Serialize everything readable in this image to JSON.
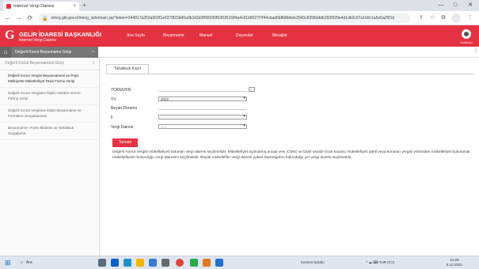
{
  "browser": {
    "tab_title": "İnternet Vergi Dairesi",
    "tab_close": "×",
    "new_tab": "+",
    "url": "intvrg.gib.gov.tr/intvrg_side/main.jsp?token=344917a3f1fa969f1e0379f22d40a3b2d3d3f00f290f63f1f51584a4c91b8027f7f44cbad0b8b8b6eb2043c835fbbfdb3926f29e4d1db2c97a1b0c1a5e5a25f1b",
    "min": "—",
    "max": "□",
    "close": "✕",
    "back": "←",
    "forward": "→",
    "reload": "⟳",
    "lock": "🔒",
    "share": "⇪",
    "star": "☆",
    "ext": "⧉",
    "menu": "⋮"
  },
  "header": {
    "logo_title": "GELİR İDARESİ BAŞKANLIĞI",
    "logo_subtitle": "İnternet Vergi Dairesi",
    "menu": [
      "Ana Sayfa",
      "Beyanname",
      "Manuel",
      "Duyurular",
      "Mesajlar"
    ],
    "user": "Kullanıcı"
  },
  "subheader": {
    "home": "⌂",
    "open_tab": "Değerli Konut Beyanname Girişi",
    "open_tab_close": "×",
    "right_icon": "⋮"
  },
  "sidebar": {
    "title": "Değerli Konut Beyannamesi Girişi",
    "collapse": "«",
    "items": [
      {
        "label": "Değerli Konut Vergisi Beyannamesi ve Paylı Mülkiyette Mükellefiyet Tesis Formu Girişi",
        "active": true
      },
      {
        "label": "Değerli Konut Vergisine İlişkin Vekalet Verme Formu Girişi",
        "active": false
      },
      {
        "label": "Değerli Konut Vergisine İlişkin Beyanname ve Formların Sorgulanması",
        "active": false
      },
      {
        "label": "Beyanname / Form Bildirimi ve Tahakkuk Sorgulama",
        "active": false
      }
    ]
  },
  "main": {
    "tab": "Tahakkuk Kayıt",
    "form": {
      "tckn_label": "TCKN/VKN",
      "tckn_value": "",
      "lookup_btn": "...",
      "year_label": "Yıl",
      "year_value": "2022",
      "period_label": "Beyan Dönemi",
      "period_value": "",
      "province_label": "İl",
      "province_value": "",
      "office_label": "Vergi Dairesi",
      "office_value": "-----"
    },
    "submit": "Tamam",
    "info": "Değerli Konut Vergisi mükellefiyeti bulunan vergi dairesi seçilmelidir. Mükellefiyet açılmamış ancak yeni (CMS) ve basit usulde ticari kazanç mükellefiyeti dahil veya konutun vergisi yönünden mükellefiyet bulunanlar mükellefiyetin bulunduğu vergi dairesini seçilmelidir. Büyük mükellefler vergi dairesi yoksa ikametgahın bulunduğu yer vergi dairesi seçilmelidir."
  },
  "taskbar": {
    "start": "⊞",
    "search_icon": "⌕",
    "search": "Ara",
    "weather": "Kısmen bulutlu",
    "tray": "^ ☁ ⌨ TUR ⊡ ⊡",
    "time": "11:29",
    "date": "8.12.2022",
    "colors": {
      "app_blue": "#1f6fd1",
      "app_green": "#2aa84a",
      "app_red": "#d93b3b",
      "app_yellow": "#f4b400"
    }
  }
}
